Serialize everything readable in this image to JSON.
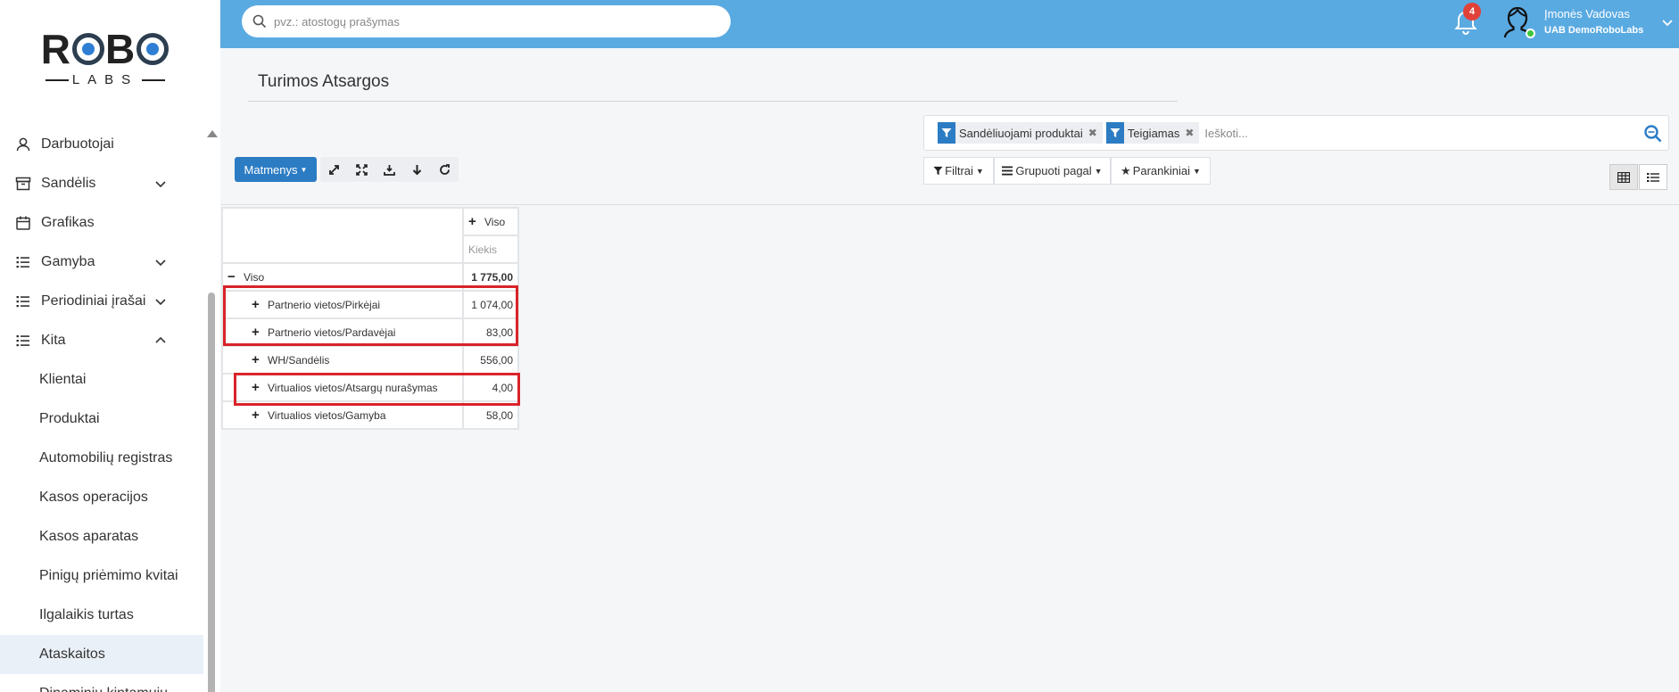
{
  "sidebar": {
    "logo": {
      "top": "ROBO",
      "bottom": "LABS"
    },
    "items": [
      {
        "label": "Darbuotojai",
        "icon": "user-icon"
      },
      {
        "label": "Sandėlis",
        "icon": "archive-icon"
      },
      {
        "label": "Grafikas",
        "icon": "calendar-icon"
      },
      {
        "label": "Gamyba",
        "icon": "list-icon"
      },
      {
        "label": "Periodiniai įrašai",
        "icon": "list-icon"
      },
      {
        "label": "Kita",
        "icon": "list-icon"
      }
    ],
    "subitems": [
      "Klientai",
      "Produktai",
      "Automobilių registras",
      "Kasos operacijos",
      "Kasos aparatas",
      "Pinigų priėmimo kvitai",
      "Ilgalaikis turtas",
      "Ataskaitos",
      "Dinaminių kintamųjų"
    ]
  },
  "topbar": {
    "search_placeholder": "pvz.: atostogų prašymas",
    "notification_count": "4",
    "user_name": "Įmonės Vadovas",
    "user_company": "UAB DemoRoboLabs"
  },
  "page": {
    "title": "Turimos Atsargos"
  },
  "filters": {
    "facets": [
      "Sandėliuojami produktai",
      "Teigiamas"
    ],
    "search_placeholder": "Ieškoti...",
    "filter_label": "Filtrai",
    "group_label": "Grupuoti pagal",
    "favorites_label": "Parankiniai"
  },
  "toolbar": {
    "dimensions_label": "Matmenys"
  },
  "pivot": {
    "col_header": "Viso",
    "measure": "Kiekis",
    "total_label": "Viso",
    "total_value": "1 775,00",
    "rows": [
      {
        "label": "Partnerio vietos/Pirkėjai",
        "value": "1 074,00"
      },
      {
        "label": "Partnerio vietos/Pardavėjai",
        "value": "83,00"
      },
      {
        "label": "WH/Sandėlis",
        "value": "556,00"
      },
      {
        "label": "Virtualios vietos/Atsargų nurašymas",
        "value": "4,00"
      },
      {
        "label": "Virtualios vietos/Gamyba",
        "value": "58,00"
      }
    ]
  },
  "colors": {
    "topbar": "#5aaae2",
    "primary": "#2c7cc4",
    "highlight": "#d9232a",
    "badge": "#e0423a"
  }
}
